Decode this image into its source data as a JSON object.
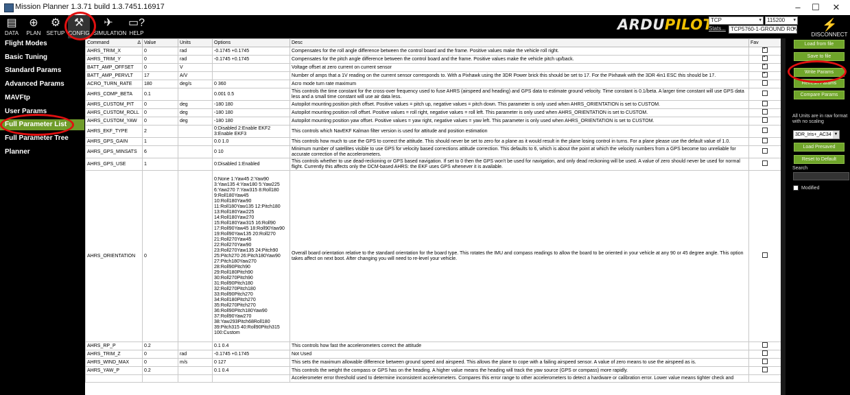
{
  "window": {
    "title": "Mission Planner 1.3.71 build 1.3.7451.16917",
    "minimize": "–",
    "maximize": "☐",
    "close": "✕"
  },
  "toolbar": {
    "data": "DATA",
    "plan": "PLAN",
    "setup": "SETUP",
    "config": "CONFIG",
    "simulation": "SIMULATION",
    "help": "HELP",
    "logo_a": "ARDU",
    "logo_b": "PILOT",
    "conn_type": "TCP",
    "baud": "115200",
    "stats": "Stats...",
    "link": "TCP5760-1-GROUND ROV",
    "disconnect": "DISCONNECT"
  },
  "sidebar": {
    "items": [
      {
        "label": "Flight Modes"
      },
      {
        "label": "Basic Tuning"
      },
      {
        "label": "Standard Params"
      },
      {
        "label": "Advanced Params"
      },
      {
        "label": "MAVFtp"
      },
      {
        "label": "User Params"
      },
      {
        "label": "Full Parameter List"
      },
      {
        "label": "Full Parameter Tree"
      },
      {
        "label": "Planner"
      }
    ]
  },
  "grid": {
    "headers": {
      "command": "Command",
      "value": "Value",
      "units": "Units",
      "options": "Options",
      "desc": "Desc",
      "fav": "Fav"
    },
    "rows": [
      {
        "cmd": "AHRS_TRIM_X",
        "val": "0",
        "units": "rad",
        "opt": "-0.1745 +0.1745",
        "desc": "Compensates for the roll angle difference between the control board and the frame. Positive values make the vehicle roll right.",
        "fav": true
      },
      {
        "cmd": "AHRS_TRIM_Y",
        "val": "0",
        "units": "rad",
        "opt": "-0.1745 +0.1745",
        "desc": "Compensates for the pitch angle difference between the control board and the frame. Positive values make the vehicle pitch up/back.",
        "fav": true
      },
      {
        "cmd": "BATT_AMP_OFFSET",
        "val": "0",
        "units": "V",
        "opt": "",
        "desc": "Voltage offset at zero current on current sensor",
        "fav": true
      },
      {
        "cmd": "BATT_AMP_PERVLT",
        "val": "17",
        "units": "A/V",
        "opt": "",
        "desc": "Number of amps that a 1V reading on the current sensor corresponds to. With a Pixhawk using the 3DR Power brick this should be set to 17. For the Pixhawk with the 3DR 4in1 ESC this should be 17.",
        "fav": true
      },
      {
        "cmd": "ACRO_TURN_RATE",
        "val": "180",
        "units": "deg/s",
        "opt": "0 360",
        "desc": "Acro mode turn rate maximum",
        "fav": false
      },
      {
        "cmd": "AHRS_COMP_BETA",
        "val": "0.1",
        "units": "",
        "opt": "0.001 0.5",
        "desc": "This controls the time constant for the cross-over frequency used to fuse AHRS (airspeed and heading) and GPS data to estimate ground velocity. Time constant is 0.1/beta. A larger time constant will use GPS data less and a small time constant will use air data less.",
        "fav": false
      },
      {
        "cmd": "AHRS_CUSTOM_PIT",
        "val": "0",
        "units": "deg",
        "opt": "-180 180",
        "desc": "Autopilot mounting position pitch offset. Positive values = pitch up, negative values = pitch down. This parameter is only used when AHRS_ORIENTATION is set to CUSTOM.",
        "fav": false
      },
      {
        "cmd": "AHRS_CUSTOM_ROLL",
        "val": "0",
        "units": "deg",
        "opt": "-180 180",
        "desc": "Autopilot mounting position roll offset. Positive values = roll right, negative values = roll left. This parameter is only used when AHRS_ORIENTATION is set to CUSTOM.",
        "fav": false
      },
      {
        "cmd": "AHRS_CUSTOM_YAW",
        "val": "0",
        "units": "deg",
        "opt": "-180 180",
        "desc": "Autopilot mounting position yaw offset. Positive values = yaw right, negative values = yaw left. This parameter is only used when AHRS_ORIENTATION is set to CUSTOM.",
        "fav": false
      },
      {
        "cmd": "AHRS_EKF_TYPE",
        "val": "2",
        "units": "",
        "opt": "0:Disabled 2:Enable EKF2\n3:Enable EKF3",
        "desc": "This controls which NavEKF Kalman filter version is used for attitude and position estimation",
        "fav": false
      },
      {
        "cmd": "AHRS_GPS_GAIN",
        "val": "1",
        "units": "",
        "opt": "0.0 1.0",
        "desc": "This controls how much to use the GPS to correct the attitude. This should never be set to zero for a plane as it would result in the plane losing control in turns. For a plane please use the default value of 1.0.",
        "fav": false
      },
      {
        "cmd": "AHRS_GPS_MINSATS",
        "val": "6",
        "units": "",
        "opt": "0 10",
        "desc": "Minimum number of satellites visible to use GPS for velocity based corrections attitude correction. This defaults to 6, which is about the point at which the velocity numbers from a GPS become too unreliable for accurate correction of the accelerometers.",
        "fav": false
      },
      {
        "cmd": "AHRS_GPS_USE",
        "val": "1",
        "units": "",
        "opt": "0:Disabled 1:Enabled",
        "desc": "This controls whether to use dead-reckoning or GPS based navigation. If set to 0 then the GPS won't be used for navigation, and only dead reckoning will be used. A value of zero should never be used for normal flight. Currently this affects only the DCM-based AHRS: the EKF uses GPS whenever it is available.",
        "fav": false
      },
      {
        "cmd": "AHRS_ORIENTATION",
        "val": "0",
        "units": "",
        "opt": "0:None 1:Yaw45 2:Yaw90\n3:Yaw135 4:Yaw180 5:Yaw225\n6:Yaw270 7:Yaw315 8:Roll180\n9:Roll180Yaw45\n10:Roll180Yaw90\n11:Roll180Yaw135 12:Pitch180\n13:Roll180Yaw225\n14:Roll180Yaw270\n15:Roll180Yaw315 16:Roll90\n17:Roll90Yaw45 18:Roll90Yaw90\n19:Roll90Yaw135 20:Roll270\n21:Roll270Yaw45\n22:Roll270Yaw90\n23:Roll270Yaw135 24:Pitch90\n25:Pitch270 26:Pitch180Yaw90\n27:Pitch180Yaw270\n28:Roll90Pitch90\n29:Roll180Pitch90\n30:Roll270Pitch90\n31:Roll90Pitch180\n32:Roll270Pitch180\n33:Roll90Pitch270\n34:Roll180Pitch270\n35:Roll270Pitch270\n36:Roll90Pitch180Yaw90\n37:Roll90Yaw270\n38:Yaw293Pitch68Roll180\n39:Pitch315 40:Roll90Pitch315\n100:Custom",
        "desc": "Overall board orientation relative to the standard orientation for the board type. This rotates the IMU and compass readings to allow the board to be oriented in your vehicle at any 90 or 45 degree angle. This option takes affect on next boot. After changing you will need to re-level your vehicle.",
        "fav": false
      },
      {
        "cmd": "AHRS_RP_P",
        "val": "0.2",
        "units": "",
        "opt": "0.1 0.4",
        "desc": "This controls how fast the accelerometers correct the attitude",
        "fav": false
      },
      {
        "cmd": "AHRS_TRIM_Z",
        "val": "0",
        "units": "rad",
        "opt": "-0.1745 +0.1745",
        "desc": "Not Used",
        "fav": false
      },
      {
        "cmd": "AHRS_WIND_MAX",
        "val": "0",
        "units": "m/s",
        "opt": "0 127",
        "desc": "This sets the maximum allowable difference between ground speed and airspeed. This allows the plane to cope with a failing airspeed sensor. A value of zero means to use the airspeed as is.",
        "fav": false
      },
      {
        "cmd": "AHRS_YAW_P",
        "val": "0.2",
        "units": "",
        "opt": "0.1 0.4",
        "desc": "This controls the weight the compass or GPS has on the heading. A higher value means the heading will track the yaw source (GPS or compass) more rapidly.",
        "fav": false
      },
      {
        "cmd": "",
        "val": "",
        "units": "",
        "opt": "",
        "desc": "Accelerometer error threshold used to determine inconsistent accelerometers. Compares this error range to other accelerometers to detect a hardware or calibration error. Lower value means tighter check and",
        "fav": false
      }
    ]
  },
  "rightpanel": {
    "load_file": "Load from file",
    "save_file": "Save to file",
    "write_params": "Write Params",
    "refresh_params": "Refresh Params",
    "compare_params": "Compare Params",
    "units_note": "All Units are in raw format with no scaling",
    "param_file": "3DR_Iris+_AC34",
    "load_presaved": "Load Presaved",
    "reset_default": "Reset to Default",
    "search_label": "Search",
    "modified_label": "Modified"
  },
  "colors": {
    "accent_green": "#6f9c2a",
    "highlight_ring": "#e01010"
  }
}
